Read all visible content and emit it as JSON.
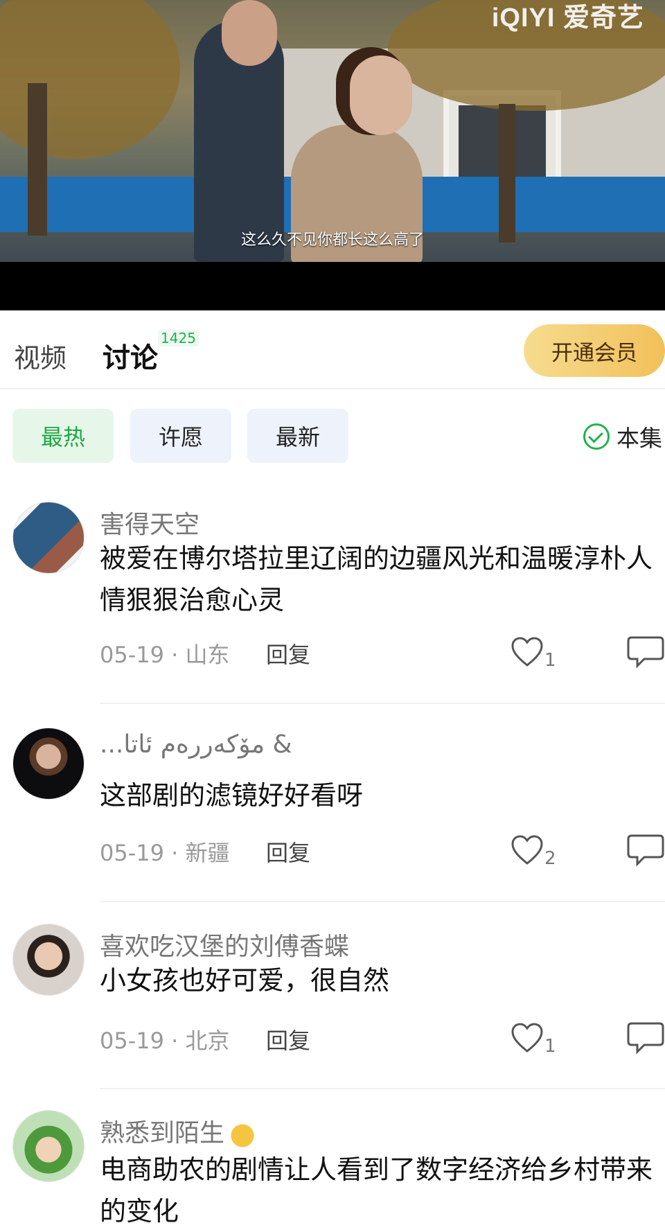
{
  "video": {
    "logo": "iQIYI 爱奇艺",
    "subtitle": "这么久不见你都长这么高了"
  },
  "tabs": {
    "video": "视频",
    "discussion": "讨论",
    "discussion_count": "1425",
    "vip_button": "开通会员"
  },
  "filters": {
    "chips": [
      "最热",
      "许愿",
      "最新"
    ],
    "active": "最热",
    "episode": "本集"
  },
  "comments": [
    {
      "user": "害得天空",
      "text": "被爱在博尔塔拉里辽阔的边疆风光和温暖淳朴人情狠狠治愈心灵",
      "date_location": "05-19 · 山东",
      "reply": "回复",
      "likes": "1"
    },
    {
      "user": "...مۆكەررەم ئاتا &",
      "text": "这部剧的滤镜好好看呀",
      "date_location": "05-19 · 新疆",
      "reply": "回复",
      "likes": "2"
    },
    {
      "user": "喜欢吃汉堡的刘傅香蝶",
      "text": "小女孩也好可爱，很自然",
      "date_location": "05-19 · 北京",
      "reply": "回复",
      "likes": "1"
    },
    {
      "user": "熟悉到陌生",
      "text": "电商助农的剧情让人看到了数字经济给乡村带来的变化",
      "date_location": "",
      "reply": "",
      "likes": ""
    }
  ],
  "colors": {
    "accent_green": "#1fb34a",
    "vip_gold": "#f2c05a"
  },
  "icons": [
    "check-circle-icon",
    "heart-icon",
    "share-icon",
    "clap-emoji-icon"
  ]
}
